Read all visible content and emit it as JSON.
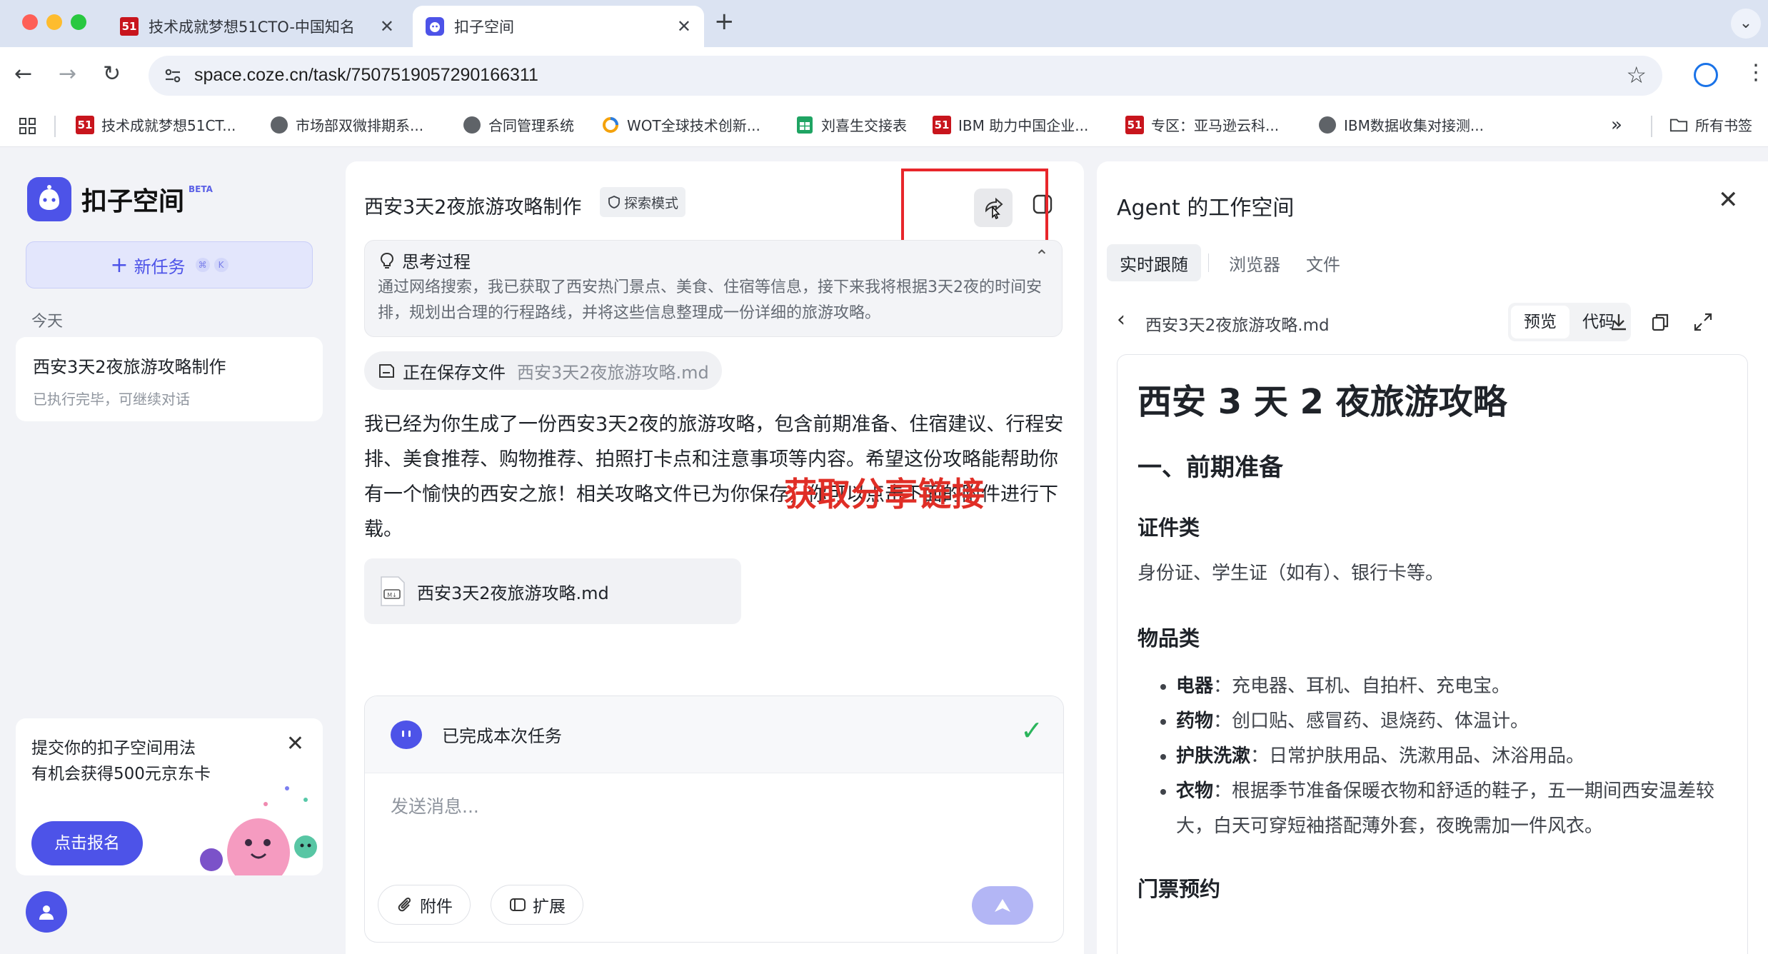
{
  "browser": {
    "tabs": [
      {
        "title": "技术成就梦想51CTO-中国知名"
      },
      {
        "title": "扣子空间"
      }
    ],
    "url": "space.coze.cn/task/7507519057290166311",
    "bookmarks": [
      {
        "label": "技术成就梦想51CT..."
      },
      {
        "label": "市场部双微排期系..."
      },
      {
        "label": "合同管理系统"
      },
      {
        "label": "WOT全球技术创新..."
      },
      {
        "label": "刘喜生交接表"
      },
      {
        "label": "IBM 助力中国企业..."
      },
      {
        "label": "专区：亚马逊云科..."
      },
      {
        "label": "IBM数据收集对接测..."
      }
    ],
    "more_bookmarks": "»",
    "all_bookmarks": "所有书签"
  },
  "sidebar": {
    "brand": "扣子空间",
    "beta": "BETA",
    "new_task": "新任务",
    "shortcut_1": "⌘",
    "shortcut_2": "K",
    "today": "今天",
    "task": {
      "title": "西安3天2夜旅游攻略制作",
      "subtitle": "已执行完毕，可继续对话"
    },
    "promo": {
      "line1": "提交你的扣子空间用法",
      "line2": "有机会获得500元京东卡",
      "button": "点击报名"
    }
  },
  "chat": {
    "title": "西安3天2夜旅游攻略制作",
    "mode_tag": "探索模式",
    "thinking_title": "思考过程",
    "thinking_text": "通过网络搜索，我已获取了西安热门景点、美食、住宿等信息，接下来我将根据3天2夜的时间安排，规划出合理的行程路线，并将这些信息整理成一份详细的旅游攻略。",
    "saving_label": "正在保存文件",
    "saving_file": "西安3天2夜旅游攻略.md",
    "reply": "我已经为你生成了一份西安3天2夜的旅游攻略，包含前期准备、住宿建议、行程安排、美食推荐、购物推荐、拍照打卡点和注意事项等内容。希望这份攻略能帮助你有一个愉快的西安之旅！相关攻略文件已为你保存，你可以点击下面的附件进行下载。",
    "overlay_caption": "获取分享链接",
    "attachment": "西安3天2夜旅游攻略.md",
    "status": "已完成本次任务",
    "input_placeholder": "发送消息...",
    "attach_btn": "附件",
    "extend_btn": "扩展"
  },
  "workspace": {
    "title": "Agent 的工作空间",
    "tabs": [
      {
        "label": "实时跟随"
      },
      {
        "label": "浏览器"
      },
      {
        "label": "文件"
      }
    ],
    "file_name": "西安3天2夜旅游攻略.md",
    "preview": "预览",
    "code": "代码",
    "doc": {
      "h1": "西安 3 天 2 夜旅游攻略",
      "h2": "一、前期准备",
      "sec1_title": "证件类",
      "sec1_text": "身份证、学生证（如有）、银行卡等。",
      "sec2_title": "物品类",
      "items": [
        {
          "label": "电器",
          "text": "：充电器、耳机、自拍杆、充电宝。"
        },
        {
          "label": "药物",
          "text": "：创口贴、感冒药、退烧药、体温计。"
        },
        {
          "label": "护肤洗漱",
          "text": "：日常护肤用品、洗漱用品、沐浴用品。"
        },
        {
          "label": "衣物",
          "text": "：根据季节准备保暖衣物和舒适的鞋子，五一期间西安温差较大，白天可穿短袖搭配薄外套，夜晚需加一件风衣。"
        }
      ],
      "sec3_title": "门票预约"
    }
  },
  "colors": {
    "accent": "#4d53e8",
    "highlight_red": "#e02e26",
    "success": "#2bb55c"
  }
}
